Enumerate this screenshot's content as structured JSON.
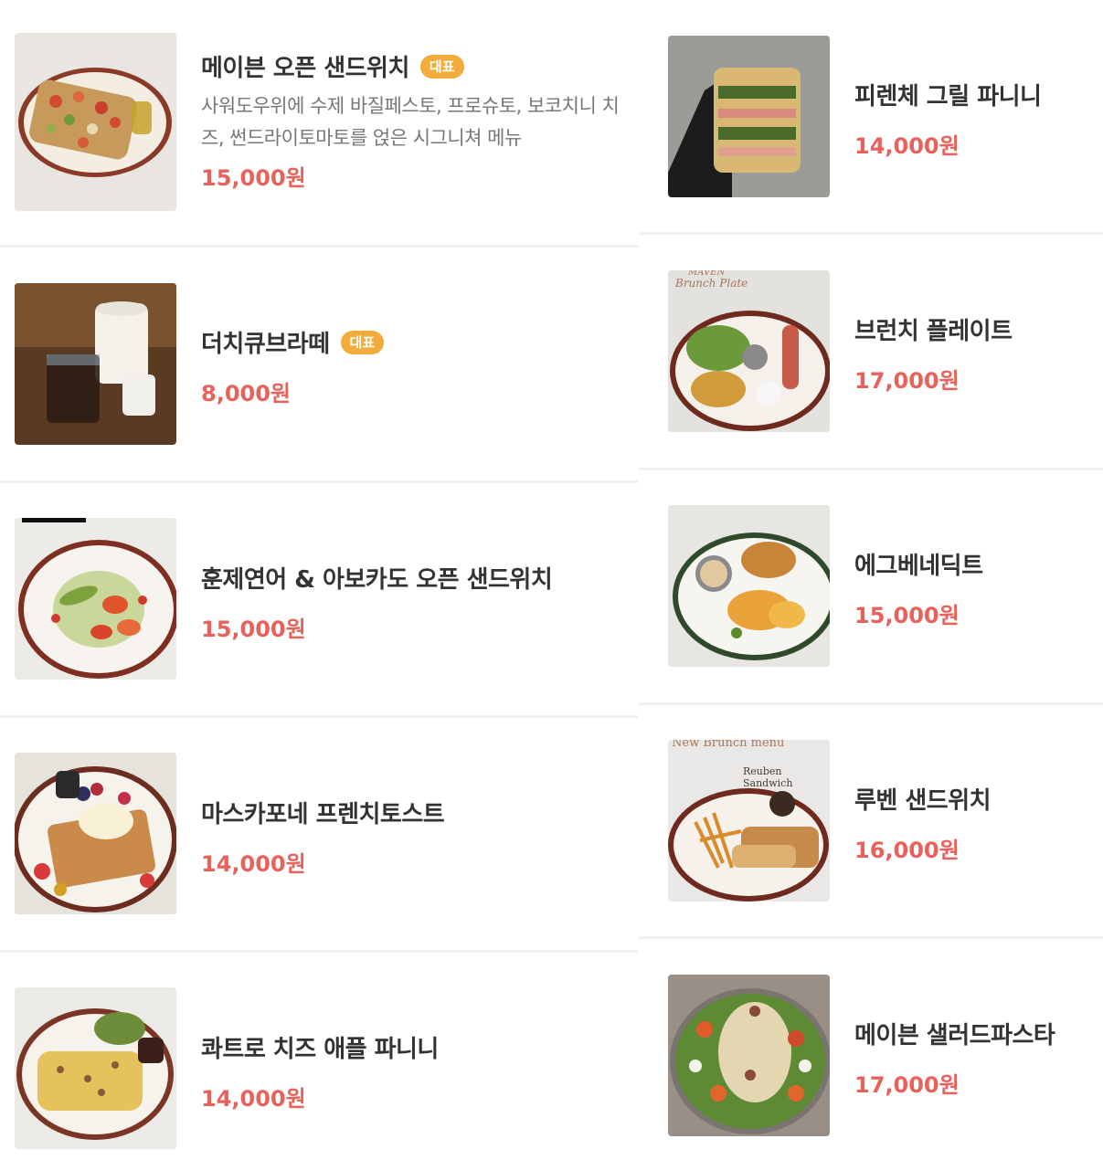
{
  "left": [
    {
      "name": "메이븐 오픈 샌드위치",
      "badge": "대표",
      "desc": "사워도우위에 수제 바질페스토, 프로슈토, 보코치니 치즈, 썬드라이토마토를 얹은 시그니쳐 메뉴",
      "price": "15,000원"
    },
    {
      "name": "더치큐브라떼",
      "badge": "대표",
      "price": "8,000원"
    },
    {
      "name": "훈제연어 & 아보카도 오픈 샌드위치",
      "price": "15,000원"
    },
    {
      "name": "마스카포네 프렌치토스트",
      "price": "14,000원"
    },
    {
      "name": "콰트로 치즈 애플 파니니",
      "price": "14,000원"
    }
  ],
  "right": [
    {
      "name": "피렌체 그릴 파니니",
      "price": "14,000원"
    },
    {
      "name": "브런치 플레이트",
      "price": "17,000원",
      "photo_text": [
        "MAVEN",
        "Brunch Plate"
      ]
    },
    {
      "name": "에그베네딕트",
      "price": "15,000원"
    },
    {
      "name": "루벤 샌드위치",
      "price": "16,000원",
      "photo_text": [
        "New Brunch menu",
        "Reuben Sandwich"
      ]
    },
    {
      "name": "메이븐 샐러드파스타",
      "price": "17,000원"
    }
  ],
  "colors": {
    "price": "#e8615a",
    "badge": "#f2ac3b",
    "name": "#333333",
    "desc": "#777777"
  }
}
